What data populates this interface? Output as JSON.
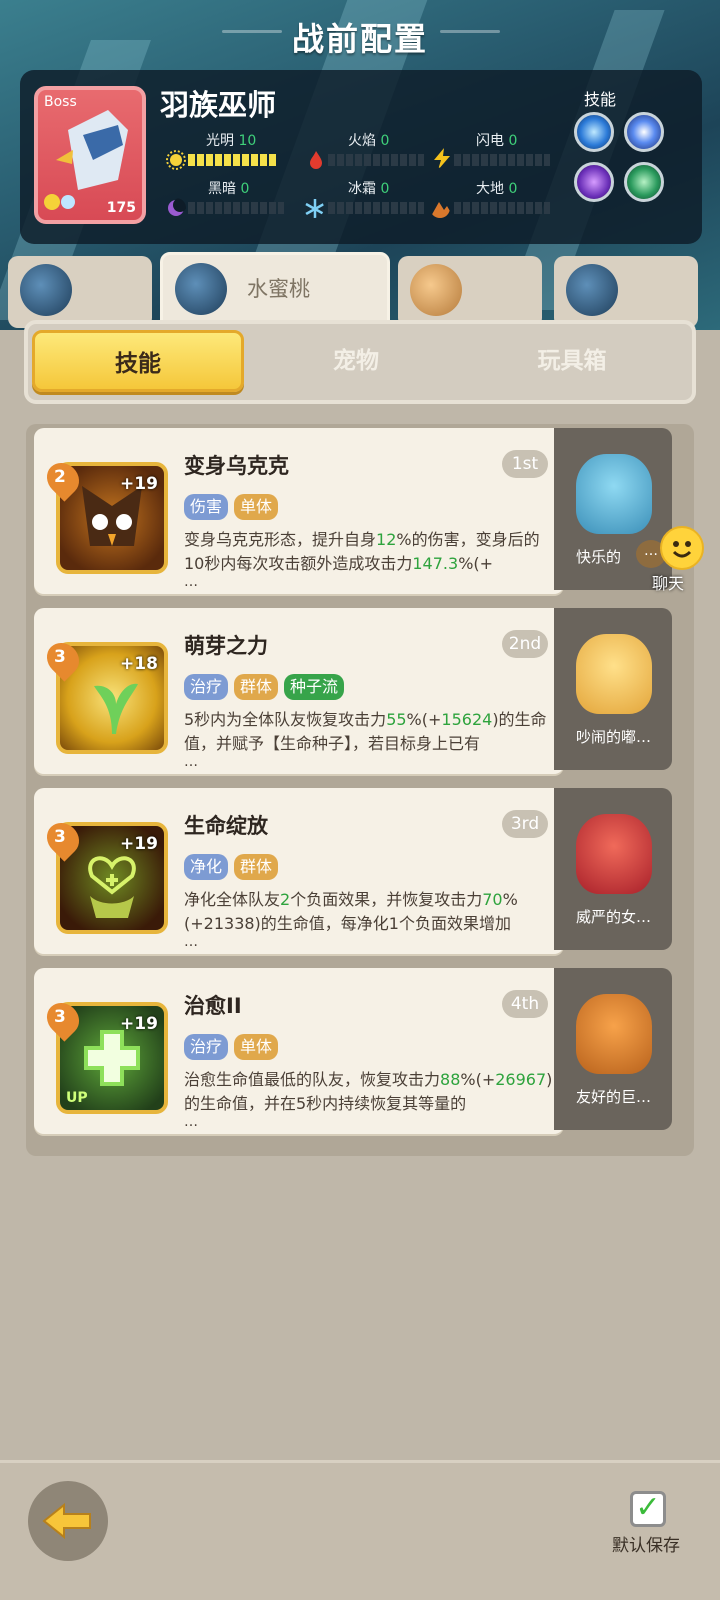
{
  "header": {
    "title": "战前配置"
  },
  "boss": {
    "tag": "Boss",
    "level": "175",
    "name": "羽族巫师",
    "skills_label": "技能",
    "elements": [
      {
        "name": "光明",
        "value": "10"
      },
      {
        "name": "火焰",
        "value": "0"
      },
      {
        "name": "闪电",
        "value": "0"
      },
      {
        "name": "黑暗",
        "value": "0"
      },
      {
        "name": "冰霜",
        "value": "0"
      },
      {
        "name": "大地",
        "value": "0"
      }
    ]
  },
  "team": {
    "active_name": "水蜜桃"
  },
  "tabs": [
    "技能",
    "宠物",
    "玩具箱"
  ],
  "skills": [
    {
      "gem": "2",
      "plus": "+19",
      "name": "变身乌克克",
      "rank": "1st",
      "tags": [
        "伤害",
        "单体"
      ],
      "desc_a": "变身乌克克形态，提升自身",
      "hl1": "12",
      "desc_b": "%的伤害，变身后的10秒内每次攻击额外造成攻击力",
      "hl2": "147.3",
      "desc_c": "%(+",
      "more": "…"
    },
    {
      "gem": "3",
      "plus": "+18",
      "name": "萌芽之力",
      "rank": "2nd",
      "tags": [
        "治疗",
        "群体",
        "种子流"
      ],
      "desc_a": "5秒内为全体队友恢复攻击力",
      "hl1": "55",
      "desc_b": "%(+",
      "hl2": "15624",
      "desc_c": ")的生命值，并赋予【生命种子】，若目标身上已有",
      "more": "…"
    },
    {
      "gem": "3",
      "plus": "+19",
      "name": "生命绽放",
      "rank": "3rd",
      "tags": [
        "净化",
        "群体"
      ],
      "desc_a": "净化全体队友",
      "hl1": "2",
      "desc_b": "个负面效果，并恢复攻击力",
      "hl2": "70",
      "desc_c": "%(+21338)的生命值，每净化1个负面效果增加",
      "more": "…"
    },
    {
      "gem": "3",
      "plus": "+19",
      "name": "治愈II",
      "rank": "4th",
      "tags": [
        "治疗",
        "单体"
      ],
      "desc_a": "治愈生命值最低的队友，恢复攻击力",
      "hl1": "88",
      "desc_b": "%(+",
      "hl2": "26967",
      "desc_c": ")的生命值，并在5秒内持续恢复其等量的",
      "more": "…"
    }
  ],
  "pets": [
    "快乐的",
    "吵闹的嘟…",
    "威严的女…",
    "友好的巨…"
  ],
  "chat": {
    "label": "聊天",
    "dots": "…"
  },
  "icon_up": "UP",
  "footer": {
    "save_label": "默认保存",
    "save_check": "✓"
  }
}
